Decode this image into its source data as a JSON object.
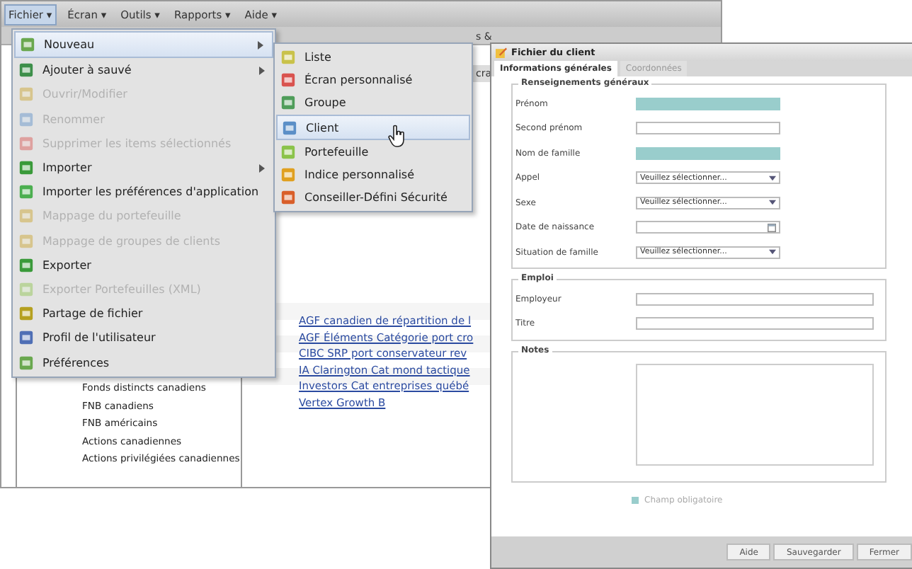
{
  "menu_bar": [
    {
      "label": "Fichier ▾",
      "selected": true
    },
    {
      "label": "Écran ▾",
      "selected": false
    },
    {
      "label": "Outils ▾",
      "selected": false
    },
    {
      "label": "Rapports ▾",
      "selected": false
    },
    {
      "label": "Aide ▾",
      "selected": false
    }
  ],
  "background": {
    "header_fragments": [
      "s &",
      "cra"
    ],
    "sidebar_items": [
      "Fonds distincts canadiens",
      "FNB canadiens",
      "FNB américains",
      "Actions canadiennes",
      "Actions privilégiées canadiennes"
    ],
    "fund_links": [
      "AGF canadien de répartition de l",
      "AGF Éléments Catégorie port cro",
      "CIBC SRP port conservateur rev",
      "IA Clarington Cat mond tactique",
      "Investors Cat entreprises québé",
      "Vertex Growth B"
    ]
  },
  "file_menu": [
    {
      "label": "Nouveau",
      "disabled": false,
      "submenu": true,
      "selected": true
    },
    {
      "label": "Ajouter à sauvé",
      "disabled": false,
      "submenu": true,
      "selected": false
    },
    {
      "label": "Ouvrir/Modifier",
      "disabled": true,
      "submenu": false,
      "selected": false
    },
    {
      "label": "Renommer",
      "disabled": true,
      "submenu": false,
      "selected": false
    },
    {
      "label": "Supprimer les items sélectionnés",
      "disabled": true,
      "submenu": false,
      "selected": false
    },
    {
      "label": "Importer",
      "disabled": false,
      "submenu": true,
      "selected": false
    },
    {
      "label": "Importer les préférences d'application",
      "disabled": false,
      "submenu": false,
      "selected": false
    },
    {
      "label": "Mappage du portefeuille",
      "disabled": true,
      "submenu": false,
      "selected": false
    },
    {
      "label": "Mappage de groupes de clients",
      "disabled": true,
      "submenu": false,
      "selected": false
    },
    {
      "label": "Exporter",
      "disabled": false,
      "submenu": false,
      "selected": false
    },
    {
      "label": "Exporter Portefeuilles (XML)",
      "disabled": true,
      "submenu": false,
      "selected": false
    },
    {
      "label": "Partage de fichier",
      "disabled": false,
      "submenu": false,
      "selected": false
    },
    {
      "label": "Profil de l'utilisateur",
      "disabled": false,
      "submenu": false,
      "selected": false
    },
    {
      "label": "Préférences",
      "disabled": false,
      "submenu": false,
      "selected": false
    }
  ],
  "new_submenu": [
    {
      "label": "Liste",
      "selected": false
    },
    {
      "label": "Écran personnalisé",
      "selected": false
    },
    {
      "label": "Groupe",
      "selected": false
    },
    {
      "label": "Client",
      "selected": true
    },
    {
      "label": "Portefeuille",
      "selected": false
    },
    {
      "label": "Indice personnalisé",
      "selected": false
    },
    {
      "label": "Conseiller-Défini Sécurité",
      "selected": false
    }
  ],
  "dialog": {
    "title": "Fichier du client",
    "tabs": [
      {
        "label": "Informations générales",
        "selected": true
      },
      {
        "label": "Coordonnées",
        "selected": false
      }
    ],
    "sections": [
      {
        "title": "Renseignements généraux",
        "fields": [
          {
            "label": "Prénom",
            "kind": "text",
            "required": true
          },
          {
            "label": "Second prénom",
            "kind": "text",
            "required": false
          },
          {
            "label": "Nom de famille",
            "kind": "text",
            "required": true
          },
          {
            "label": "Appel",
            "kind": "select",
            "value": "Veuillez sélectionner..."
          },
          {
            "label": "Sexe",
            "kind": "select",
            "value": "Veuillez sélectionner..."
          },
          {
            "label": "Date de naissance",
            "kind": "date"
          },
          {
            "label": "Situation de famille",
            "kind": "select",
            "value": "Veuillez sélectionner..."
          }
        ]
      },
      {
        "title": "Emploi",
        "fields": [
          {
            "label": "Employeur",
            "kind": "text",
            "required": false
          },
          {
            "label": "Titre",
            "kind": "text",
            "required": false
          }
        ]
      },
      {
        "title": "Notes",
        "fields": [
          {
            "kind": "textarea"
          }
        ]
      }
    ],
    "required_legend": "Champ obligatoire",
    "buttons": [
      "Aide",
      "Sauvegarder",
      "Fermer"
    ]
  }
}
